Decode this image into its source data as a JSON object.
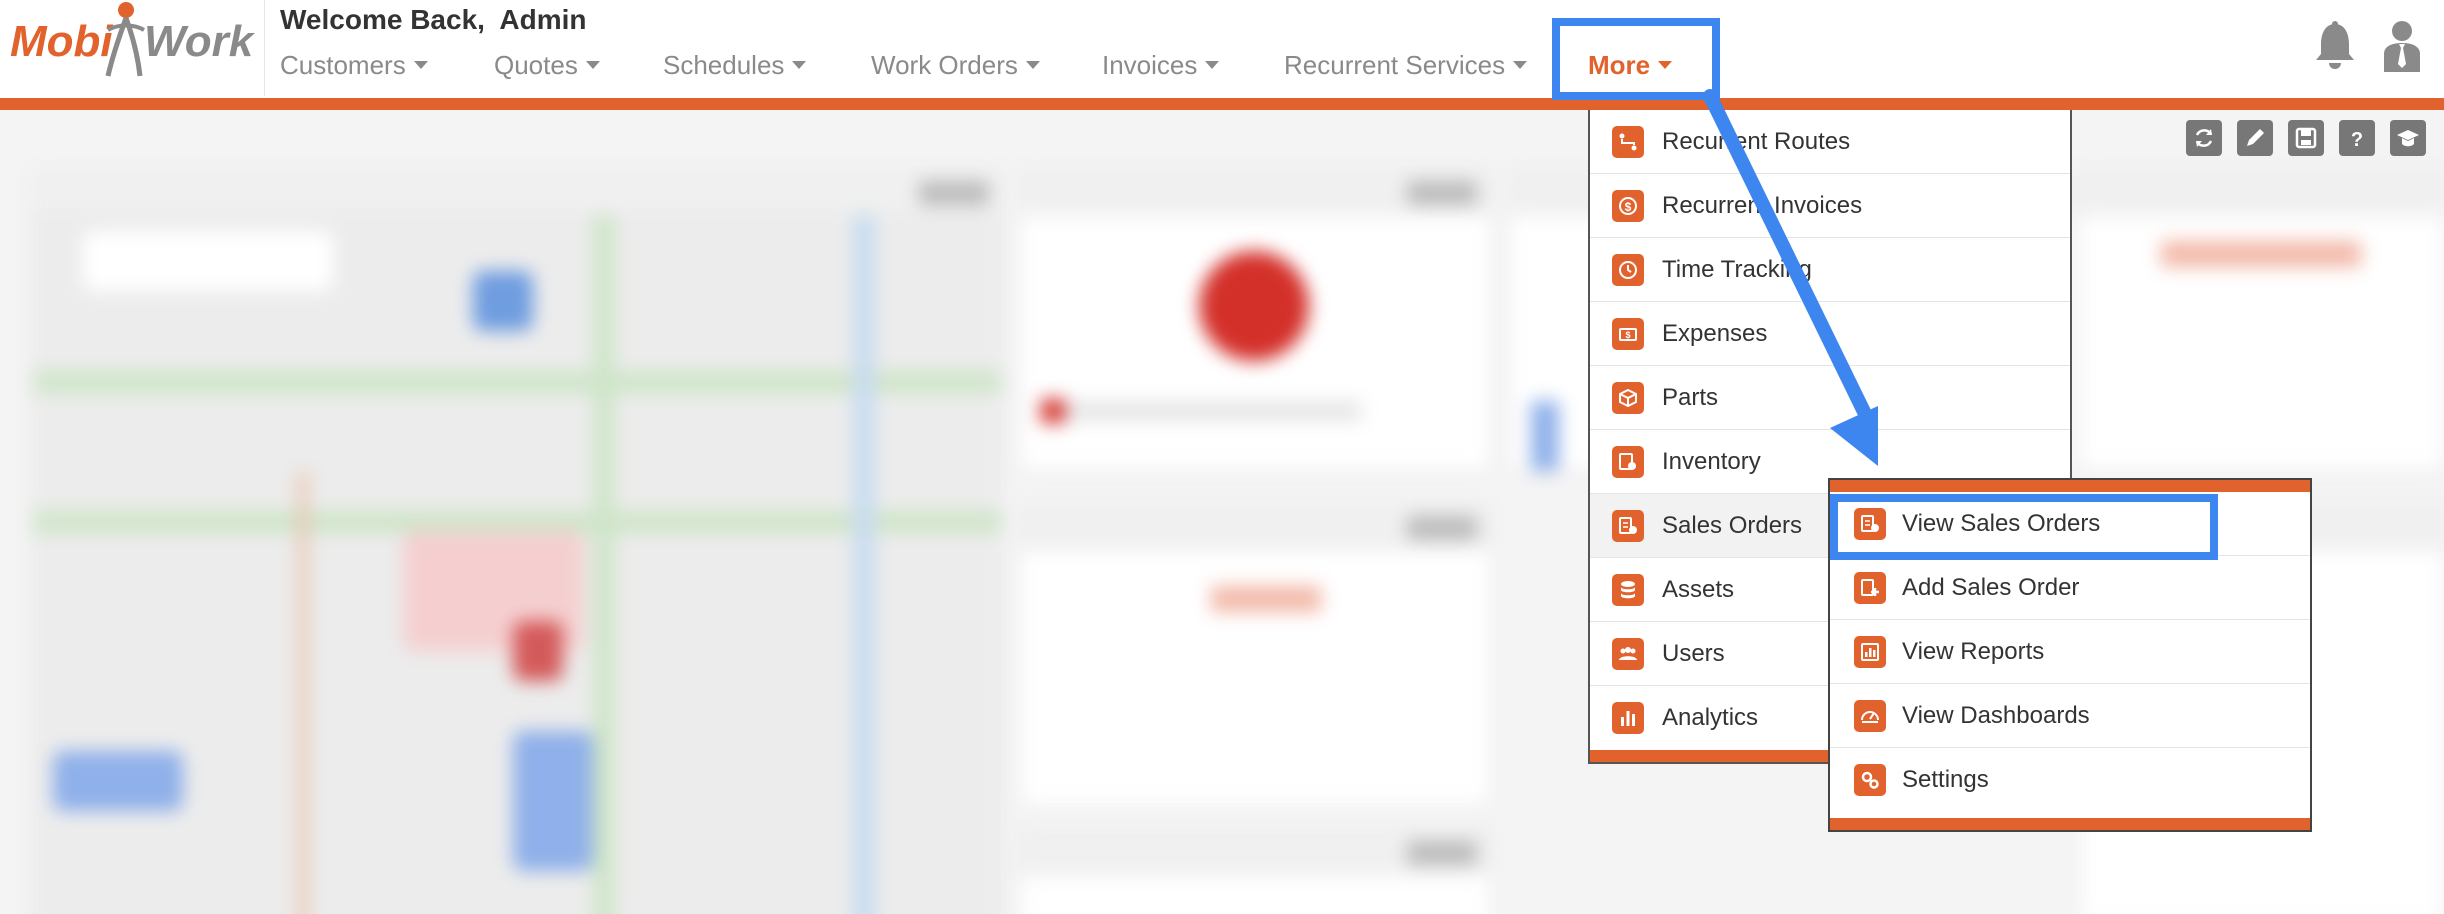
{
  "header": {
    "logo_text_left": "Mobi",
    "logo_text_right": "Work",
    "welcome": "Welcome Back,  Admin"
  },
  "nav": [
    {
      "label": "Customers"
    },
    {
      "label": "Quotes"
    },
    {
      "label": "Schedules"
    },
    {
      "label": "Work Orders"
    },
    {
      "label": "Invoices"
    },
    {
      "label": "Recurrent Services"
    },
    {
      "label": "More"
    }
  ],
  "icons": {
    "notifications": "bell-icon",
    "profile": "user-icon",
    "toolbar": [
      "refresh-icon",
      "pencil-icon",
      "save-icon",
      "help-icon",
      "graduation-cap-icon"
    ]
  },
  "more_menu": {
    "items": [
      {
        "label": "Recurrent Routes",
        "icon": "route-icon"
      },
      {
        "label": "Recurrent Invoices",
        "icon": "dollar-cycle-icon"
      },
      {
        "label": "Time Tracking",
        "icon": "clock-icon"
      },
      {
        "label": "Expenses",
        "icon": "money-icon"
      },
      {
        "label": "Parts",
        "icon": "box-icon"
      },
      {
        "label": "Inventory",
        "icon": "inventory-icon"
      },
      {
        "label": "Sales Orders",
        "icon": "sales-order-icon"
      },
      {
        "label": "Assets",
        "icon": "database-icon"
      },
      {
        "label": "Users",
        "icon": "users-icon"
      },
      {
        "label": "Analytics",
        "icon": "bar-chart-icon"
      }
    ]
  },
  "sales_orders_submenu": {
    "items": [
      {
        "label": "View Sales Orders",
        "icon": "view-sales-order-icon"
      },
      {
        "label": "Add Sales Order",
        "icon": "add-sales-order-icon"
      },
      {
        "label": "View Reports",
        "icon": "report-icon"
      },
      {
        "label": "View Dashboards",
        "icon": "dashboard-gauge-icon"
      },
      {
        "label": "Settings",
        "icon": "gears-icon"
      }
    ]
  },
  "colors": {
    "brand": "#e2622e",
    "highlight": "#3d86f0",
    "nav_text": "#8a8a8a"
  }
}
